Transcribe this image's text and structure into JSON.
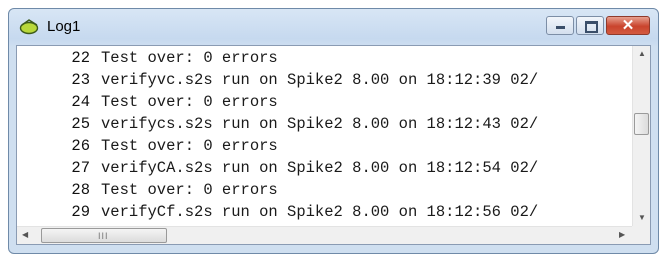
{
  "window": {
    "title": "Log1",
    "title_icon": "log-view-icon",
    "buttons": {
      "minimize": "minimize-icon",
      "maximize": "maximize-icon",
      "close": "close-icon"
    }
  },
  "log": {
    "lines": [
      {
        "number": "22",
        "text": "Test over: 0 errors"
      },
      {
        "number": "23",
        "text": "verifyvc.s2s run on Spike2 8.00 on 18:12:39 02/"
      },
      {
        "number": "24",
        "text": "Test over: 0 errors"
      },
      {
        "number": "25",
        "text": "verifycs.s2s run on Spike2 8.00 on 18:12:43 02/"
      },
      {
        "number": "26",
        "text": "Test over: 0 errors"
      },
      {
        "number": "27",
        "text": "verifyCA.s2s run on Spike2 8.00 on 18:12:54 02/"
      },
      {
        "number": "28",
        "text": "Test over: 0 errors"
      },
      {
        "number": "29",
        "text": "verifyCf.s2s run on Spike2 8.00 on 18:12:56 02/"
      }
    ]
  },
  "scrollbars": {
    "horizontal_grip": "III",
    "up_arrow": "▲",
    "down_arrow": "▼",
    "left_arrow": "◀",
    "right_arrow": "▶"
  },
  "colors": {
    "titlebar": "#c6d9ef",
    "close_button": "#c9442d"
  }
}
